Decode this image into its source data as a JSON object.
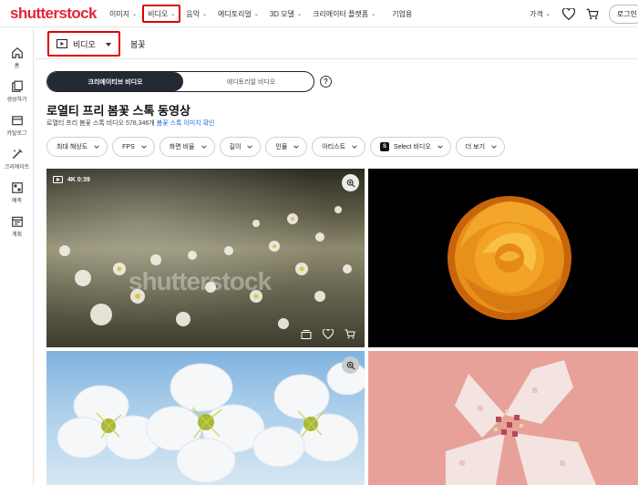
{
  "brand": {
    "logo": "shutterstock",
    "accent": "#e1253a"
  },
  "nav": {
    "items": [
      {
        "label": "이미지",
        "chevron": true,
        "active": false
      },
      {
        "label": "비디오",
        "chevron": true,
        "active": true
      },
      {
        "label": "음악",
        "chevron": true,
        "active": false
      },
      {
        "label": "에디토리얼",
        "chevron": true,
        "active": false
      },
      {
        "label": "3D 모델",
        "chevron": true,
        "active": false
      },
      {
        "label": "크리에이터 플랫폼",
        "chevron": true,
        "active": false
      },
      {
        "label": "기업용",
        "chevron": false,
        "active": false
      }
    ],
    "pricing": "가격",
    "login": "로그인"
  },
  "sidebar": {
    "items": [
      {
        "label": "홈",
        "icon": "home-icon"
      },
      {
        "label": "생성하기",
        "icon": "create-icon"
      },
      {
        "label": "카탈로그",
        "icon": "catalog-icon"
      },
      {
        "label": "크리에이트",
        "icon": "magic-icon"
      },
      {
        "label": "예측",
        "icon": "predict-icon"
      },
      {
        "label": "계획",
        "icon": "plan-icon"
      }
    ]
  },
  "search": {
    "media_type": "비디오",
    "query": "봄꽃"
  },
  "toggle": {
    "creative": "크리에이티브 비디오",
    "editorial": "에디토리얼 비디오",
    "help": "?"
  },
  "title": "로열티 프리 봄꽃 스톡 동영상",
  "subtitle": {
    "text": "로열티 프리 봄꽃 스톡 비디오 578,346개",
    "link": "봄꽃 스톡 이미지 확인"
  },
  "filters": [
    {
      "label": "최대 해상도"
    },
    {
      "label": "FPS"
    },
    {
      "label": "화면 비율"
    },
    {
      "label": "길이"
    },
    {
      "label": "인물"
    },
    {
      "label": "아티스트"
    },
    {
      "label": "Select 비디오",
      "badge": "S"
    },
    {
      "label": "더 보기"
    }
  ],
  "results": [
    {
      "duration": "4K 0:39",
      "watermark": "shutterstock"
    }
  ]
}
